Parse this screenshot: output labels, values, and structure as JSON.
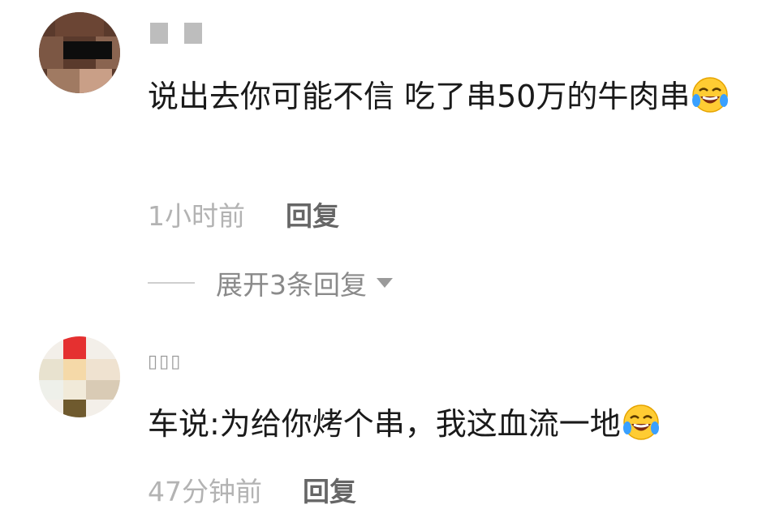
{
  "comments": [
    {
      "username": "",
      "text": "说出去你可能不信 吃了串50万的牛肉串",
      "emoji": "rofl-emoji",
      "time": "1小时前",
      "reply_label": "回复",
      "expand_label": "展开3条回复"
    },
    {
      "username": "▯▯▯",
      "text": "车说:为给你烤个串，我这血流一地",
      "emoji": "rofl-emoji",
      "time": "47分钟前",
      "reply_label": "回复"
    }
  ],
  "colors": {
    "text": "#1a1a1a",
    "meta": "#b3b3b3",
    "reply": "#666666"
  }
}
